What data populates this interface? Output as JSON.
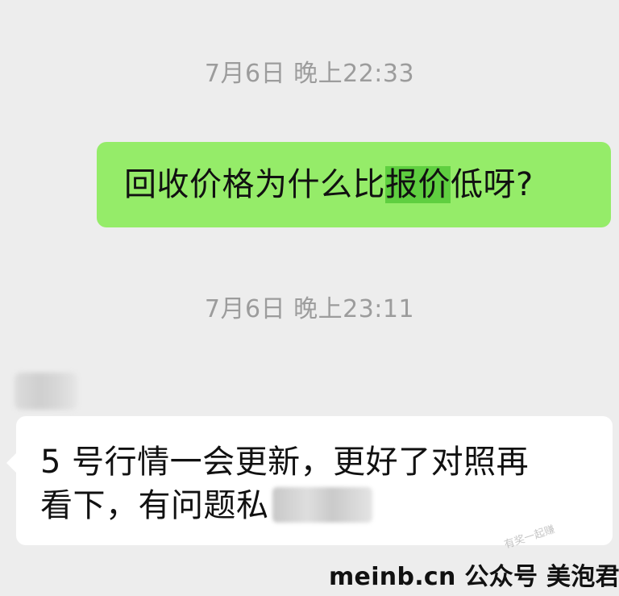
{
  "messages": [
    {
      "type": "timestamp",
      "text": "7月6日 晚上22:33"
    },
    {
      "type": "sent",
      "text_before": "回收价格为什么比",
      "text_highlight": "报价",
      "text_after": "低呀?"
    },
    {
      "type": "timestamp",
      "text": "7月6日 晚上23:11"
    },
    {
      "type": "received",
      "line1": "5 号行情一会更新，更好了对照再",
      "line2": "看下，有问题私"
    }
  ],
  "watermark": {
    "text": "meinb.cn  公众号 美泡君",
    "faint_text": "有奖一起赚"
  },
  "colors": {
    "background": "#ededed",
    "sent_bubble": "#95ec69",
    "highlight": "#5fcf40",
    "received_bubble": "#ffffff",
    "timestamp_text": "#9c9c9c"
  }
}
